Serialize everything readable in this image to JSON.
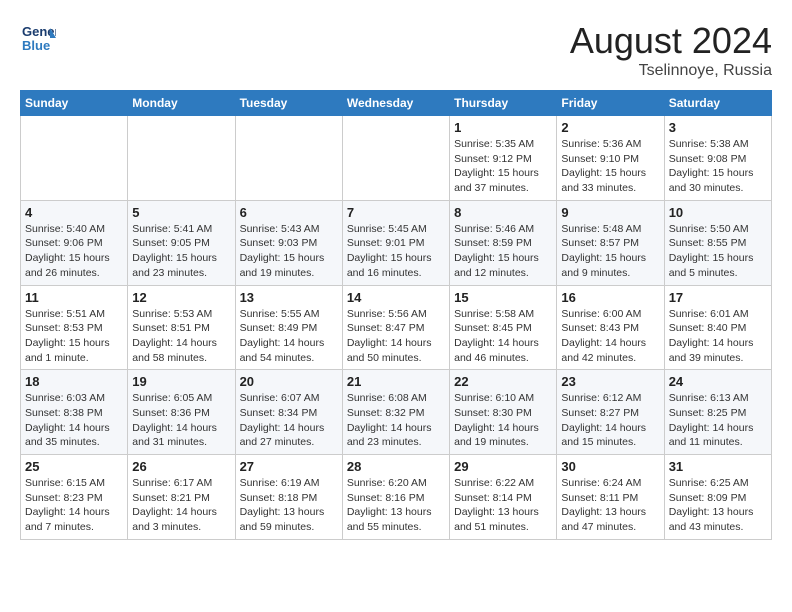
{
  "header": {
    "logo": {
      "line1": "General",
      "line2": "Blue"
    },
    "month_year": "August 2024",
    "location": "Tselinnoye, Russia"
  },
  "weekdays": [
    "Sunday",
    "Monday",
    "Tuesday",
    "Wednesday",
    "Thursday",
    "Friday",
    "Saturday"
  ],
  "weeks": [
    [
      {
        "day": "",
        "info": ""
      },
      {
        "day": "",
        "info": ""
      },
      {
        "day": "",
        "info": ""
      },
      {
        "day": "",
        "info": ""
      },
      {
        "day": "1",
        "info": "Sunrise: 5:35 AM\nSunset: 9:12 PM\nDaylight: 15 hours\nand 37 minutes."
      },
      {
        "day": "2",
        "info": "Sunrise: 5:36 AM\nSunset: 9:10 PM\nDaylight: 15 hours\nand 33 minutes."
      },
      {
        "day": "3",
        "info": "Sunrise: 5:38 AM\nSunset: 9:08 PM\nDaylight: 15 hours\nand 30 minutes."
      }
    ],
    [
      {
        "day": "4",
        "info": "Sunrise: 5:40 AM\nSunset: 9:06 PM\nDaylight: 15 hours\nand 26 minutes."
      },
      {
        "day": "5",
        "info": "Sunrise: 5:41 AM\nSunset: 9:05 PM\nDaylight: 15 hours\nand 23 minutes."
      },
      {
        "day": "6",
        "info": "Sunrise: 5:43 AM\nSunset: 9:03 PM\nDaylight: 15 hours\nand 19 minutes."
      },
      {
        "day": "7",
        "info": "Sunrise: 5:45 AM\nSunset: 9:01 PM\nDaylight: 15 hours\nand 16 minutes."
      },
      {
        "day": "8",
        "info": "Sunrise: 5:46 AM\nSunset: 8:59 PM\nDaylight: 15 hours\nand 12 minutes."
      },
      {
        "day": "9",
        "info": "Sunrise: 5:48 AM\nSunset: 8:57 PM\nDaylight: 15 hours\nand 9 minutes."
      },
      {
        "day": "10",
        "info": "Sunrise: 5:50 AM\nSunset: 8:55 PM\nDaylight: 15 hours\nand 5 minutes."
      }
    ],
    [
      {
        "day": "11",
        "info": "Sunrise: 5:51 AM\nSunset: 8:53 PM\nDaylight: 15 hours\nand 1 minute."
      },
      {
        "day": "12",
        "info": "Sunrise: 5:53 AM\nSunset: 8:51 PM\nDaylight: 14 hours\nand 58 minutes."
      },
      {
        "day": "13",
        "info": "Sunrise: 5:55 AM\nSunset: 8:49 PM\nDaylight: 14 hours\nand 54 minutes."
      },
      {
        "day": "14",
        "info": "Sunrise: 5:56 AM\nSunset: 8:47 PM\nDaylight: 14 hours\nand 50 minutes."
      },
      {
        "day": "15",
        "info": "Sunrise: 5:58 AM\nSunset: 8:45 PM\nDaylight: 14 hours\nand 46 minutes."
      },
      {
        "day": "16",
        "info": "Sunrise: 6:00 AM\nSunset: 8:43 PM\nDaylight: 14 hours\nand 42 minutes."
      },
      {
        "day": "17",
        "info": "Sunrise: 6:01 AM\nSunset: 8:40 PM\nDaylight: 14 hours\nand 39 minutes."
      }
    ],
    [
      {
        "day": "18",
        "info": "Sunrise: 6:03 AM\nSunset: 8:38 PM\nDaylight: 14 hours\nand 35 minutes."
      },
      {
        "day": "19",
        "info": "Sunrise: 6:05 AM\nSunset: 8:36 PM\nDaylight: 14 hours\nand 31 minutes."
      },
      {
        "day": "20",
        "info": "Sunrise: 6:07 AM\nSunset: 8:34 PM\nDaylight: 14 hours\nand 27 minutes."
      },
      {
        "day": "21",
        "info": "Sunrise: 6:08 AM\nSunset: 8:32 PM\nDaylight: 14 hours\nand 23 minutes."
      },
      {
        "day": "22",
        "info": "Sunrise: 6:10 AM\nSunset: 8:30 PM\nDaylight: 14 hours\nand 19 minutes."
      },
      {
        "day": "23",
        "info": "Sunrise: 6:12 AM\nSunset: 8:27 PM\nDaylight: 14 hours\nand 15 minutes."
      },
      {
        "day": "24",
        "info": "Sunrise: 6:13 AM\nSunset: 8:25 PM\nDaylight: 14 hours\nand 11 minutes."
      }
    ],
    [
      {
        "day": "25",
        "info": "Sunrise: 6:15 AM\nSunset: 8:23 PM\nDaylight: 14 hours\nand 7 minutes."
      },
      {
        "day": "26",
        "info": "Sunrise: 6:17 AM\nSunset: 8:21 PM\nDaylight: 14 hours\nand 3 minutes."
      },
      {
        "day": "27",
        "info": "Sunrise: 6:19 AM\nSunset: 8:18 PM\nDaylight: 13 hours\nand 59 minutes."
      },
      {
        "day": "28",
        "info": "Sunrise: 6:20 AM\nSunset: 8:16 PM\nDaylight: 13 hours\nand 55 minutes."
      },
      {
        "day": "29",
        "info": "Sunrise: 6:22 AM\nSunset: 8:14 PM\nDaylight: 13 hours\nand 51 minutes."
      },
      {
        "day": "30",
        "info": "Sunrise: 6:24 AM\nSunset: 8:11 PM\nDaylight: 13 hours\nand 47 minutes."
      },
      {
        "day": "31",
        "info": "Sunrise: 6:25 AM\nSunset: 8:09 PM\nDaylight: 13 hours\nand 43 minutes."
      }
    ]
  ]
}
